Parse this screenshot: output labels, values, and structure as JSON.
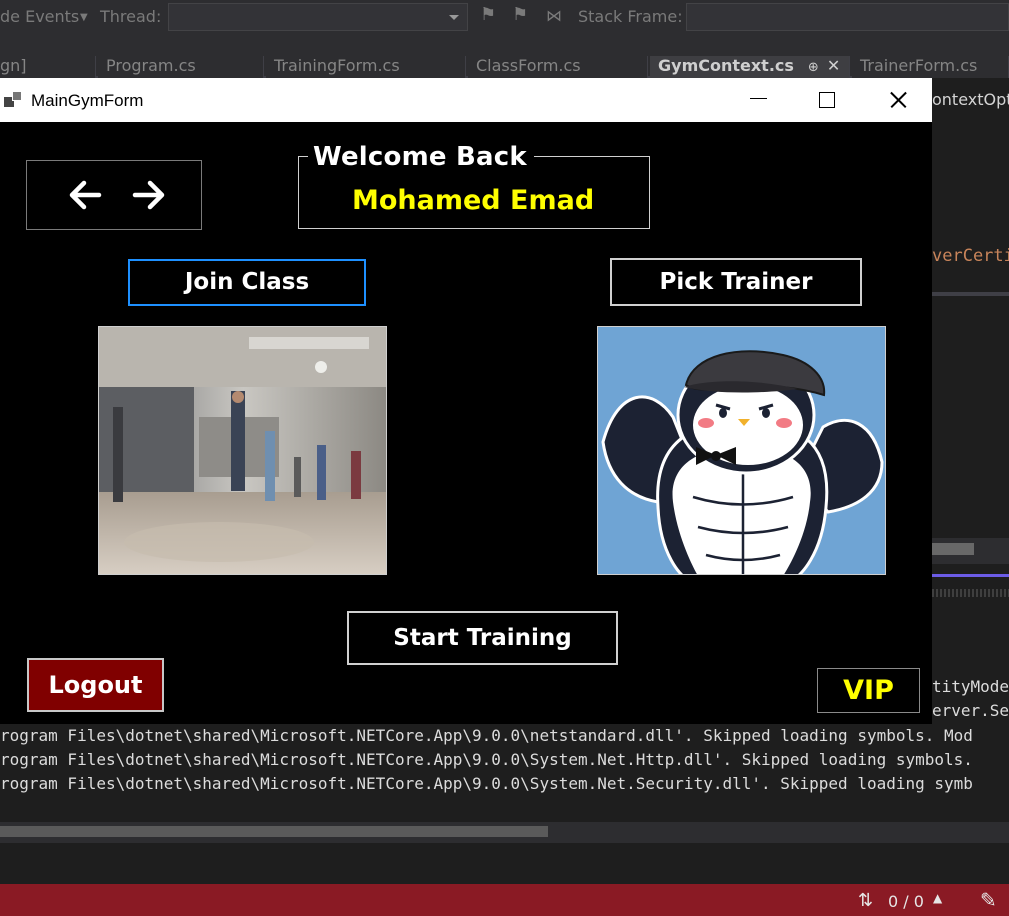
{
  "ide": {
    "toolbar": {
      "events_label": "de Events",
      "thread_label": "Thread:",
      "stack_frame_label": "Stack Frame:"
    },
    "tabs": [
      {
        "label": "gn]"
      },
      {
        "label": "Program.cs"
      },
      {
        "label": "TrainingForm.cs"
      },
      {
        "label": "ClassForm.cs"
      },
      {
        "label": "GymContext.cs",
        "pin": "⊕",
        "close": "✕"
      },
      {
        "label": "TrainerForm.cs"
      }
    ],
    "editor": {
      "context_options_text": "ontextOpti",
      "server_cert_text": "verCerti"
    },
    "output": {
      "right_line1": "tityMode",
      "right_line2": "erver.Se",
      "lines": [
        "rogram Files\\dotnet\\shared\\Microsoft.NETCore.App\\9.0.0\\netstandard.dll'. Skipped loading symbols. Mod",
        "rogram Files\\dotnet\\shared\\Microsoft.NETCore.App\\9.0.0\\System.Net.Http.dll'. Skipped loading symbols.",
        "rogram Files\\dotnet\\shared\\Microsoft.NETCore.App\\9.0.0\\System.Net.Security.dll'. Skipped loading symb"
      ]
    },
    "status": {
      "arrows": "⇅",
      "count": "0 / 0",
      "up_icon": "▲",
      "pen_icon": "✎"
    }
  },
  "window": {
    "title": "MainGymForm",
    "welcome": {
      "label": "Welcome Back",
      "user_name": "Mohamed Emad"
    },
    "buttons": {
      "join_class": "Join Class",
      "pick_trainer": "Pick Trainer",
      "start_training": "Start Training",
      "logout": "Logout",
      "vip": "VIP"
    },
    "colors": {
      "user_name": "#ffff00",
      "vip": "#ffff00",
      "logout_bg": "#800000",
      "focus_border": "#1e90ff"
    }
  }
}
